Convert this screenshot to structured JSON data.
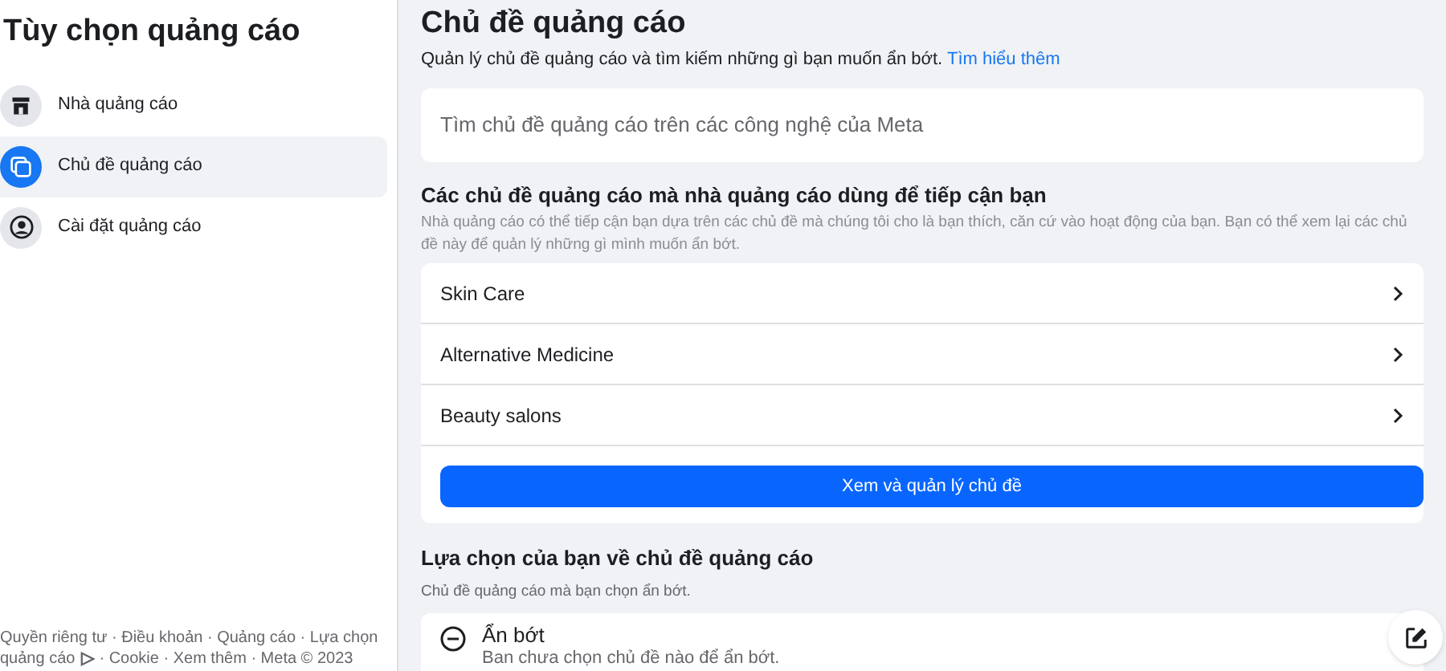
{
  "sidebar": {
    "title": "Tùy chọn quảng cáo",
    "items": [
      {
        "label": "Nhà quảng cáo",
        "kind": "store",
        "selected": false
      },
      {
        "label": "Chủ đề quảng cáo",
        "kind": "topics",
        "selected": true
      },
      {
        "label": "Cài đặt quảng cáo",
        "kind": "person",
        "selected": false
      }
    ],
    "footer_line_1": "Quyền riêng tư · Điều khoản · Quảng cáo · Lựa chọn",
    "footer_before_icon": "quảng cáo",
    "footer_after_icon": "· Cookie · Xem thêm · Meta © 2023"
  },
  "main": {
    "title": "Chủ đề quảng cáo",
    "subtitle": "Quản lý chủ đề quảng cáo và tìm kiếm những gì bạn muốn ẩn bớt.",
    "learn_more": "Tìm hiểu thêm",
    "search": {
      "placeholder": "Tìm chủ đề quảng cáo trên các công nghệ của Meta"
    },
    "topics_section": {
      "heading": "Các chủ đề quảng cáo mà nhà quảng cáo dùng để tiếp cận bạn",
      "description": "Nhà quảng cáo có thể tiếp cận bạn dựa trên các chủ đề mà chúng tôi cho là bạn thích, căn cứ vào hoạt động của bạn. Bạn có thể xem lại các chủ đề này để quản lý những gì mình muốn ẩn bớt.",
      "topics": [
        "Skin Care",
        "Alternative Medicine",
        "Beauty salons"
      ],
      "button": "Xem và quản lý chủ đề"
    },
    "choices_section": {
      "heading": "Lựa chọn của bạn về chủ đề quảng cáo",
      "description": "Chủ đề quảng cáo mà bạn chọn ẩn bớt.",
      "card_title": "Ẩn bớt",
      "card_text": "Ban chưa chọn chủ đề nào để ẩn bớt."
    }
  }
}
